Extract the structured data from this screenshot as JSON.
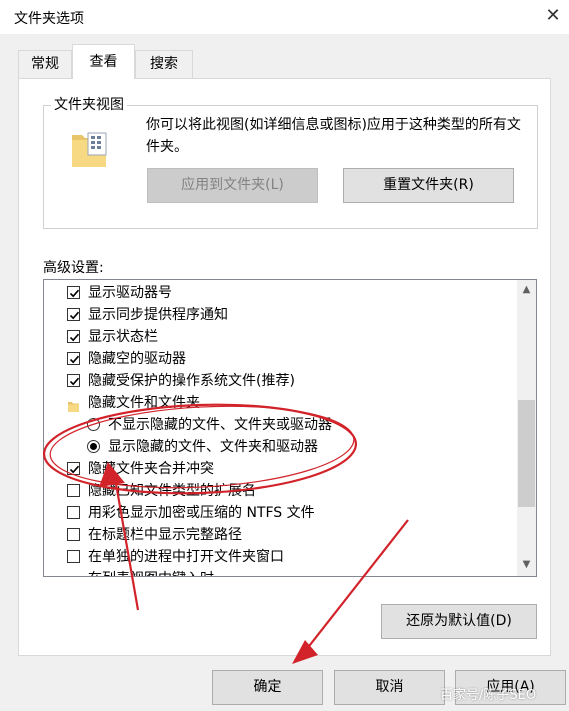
{
  "window": {
    "title": "文件夹选项",
    "close_icon": "close-icon"
  },
  "tabs": [
    {
      "label": "常规"
    },
    {
      "label": "查看"
    },
    {
      "label": "搜索"
    }
  ],
  "folder_view": {
    "legend": "文件夹视图",
    "description": "你可以将此视图(如详细信息或图标)应用于这种类型的所有文件夹。",
    "apply_button": "应用到文件夹(L)",
    "reset_button": "重置文件夹(R)"
  },
  "advanced": {
    "label": "高级设置:",
    "items": [
      {
        "label": "显示驱动器号",
        "type": "checkbox",
        "checked": true
      },
      {
        "label": "显示同步提供程序通知",
        "type": "checkbox",
        "checked": true
      },
      {
        "label": "显示状态栏",
        "type": "checkbox",
        "checked": true
      },
      {
        "label": "隐藏空的驱动器",
        "type": "checkbox",
        "checked": true
      },
      {
        "label": "隐藏受保护的操作系统文件(推荐)",
        "type": "checkbox",
        "checked": true
      },
      {
        "label": "隐藏文件和文件夹",
        "type": "folder"
      },
      {
        "label": "不显示隐藏的文件、文件夹或驱动器",
        "type": "radio",
        "checked": false
      },
      {
        "label": "显示隐藏的文件、文件夹和驱动器",
        "type": "radio",
        "checked": true
      },
      {
        "label": "隐藏文件夹合并冲突",
        "type": "checkbox",
        "checked": true
      },
      {
        "label": "隐藏已知文件类型的扩展名",
        "type": "checkbox",
        "checked": false
      },
      {
        "label": "用彩色显示加密或压缩的 NTFS 文件",
        "type": "checkbox",
        "checked": false
      },
      {
        "label": "在标题栏中显示完整路径",
        "type": "checkbox",
        "checked": false
      },
      {
        "label": "在单独的进程中打开文件夹窗口",
        "type": "checkbox",
        "checked": false
      },
      {
        "label": "在列表视图中键入时",
        "type": "folder"
      }
    ],
    "restore_button": "还原为默认值(D)"
  },
  "footer": {
    "ok": "确定",
    "cancel": "取消",
    "apply": "应用(A)"
  },
  "watermark": "百家号/陈子SEO",
  "colors": {
    "annotation": "#d2232a",
    "checkbox_border": "#333333"
  }
}
